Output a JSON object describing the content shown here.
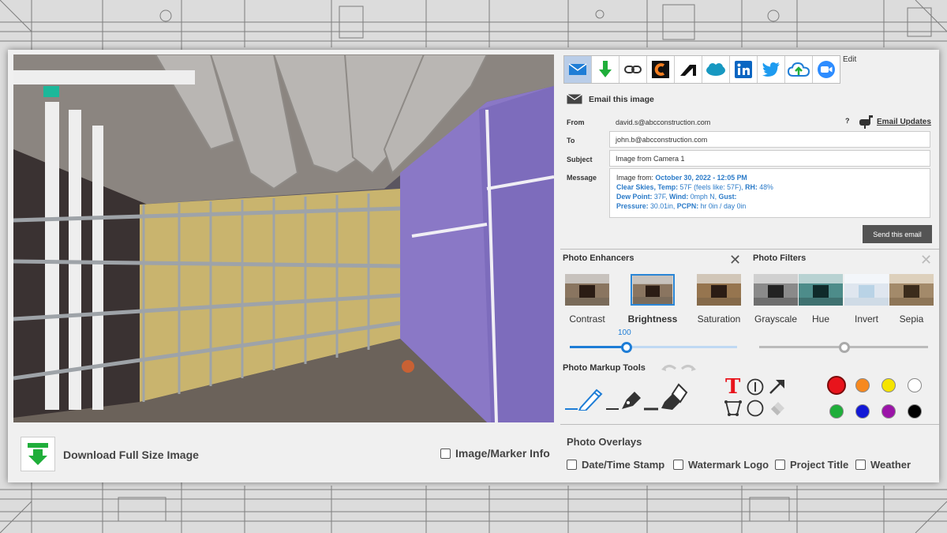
{
  "download": {
    "label": "Download Full Size Image"
  },
  "marker_info": {
    "label": "Image/Marker Info"
  },
  "share": {
    "icons": [
      "email-icon",
      "download-icon",
      "link-icon",
      "procore-icon",
      "autodesk-icon",
      "salesforce-icon",
      "linkedin-icon",
      "twitter-icon",
      "cloud-upload-icon",
      "zoom-icon"
    ],
    "edit_label": "Edit"
  },
  "email": {
    "title": "Email this image",
    "from_label": "From",
    "from_value": "david.s@abcconstruction.com",
    "help": "?",
    "updates_label": "Email Updates",
    "to_label": "To",
    "to_value": "john.b@abcconstruction.com",
    "subject_label": "Subject",
    "subject_value": "Image from Camera 1",
    "message_label": "Message",
    "message": {
      "l1a": "Image from: ",
      "l1b": "October 30, 2022 - 12:05 PM",
      "l2a": "Clear Skies, Temp: ",
      "l2b": "57F (feels like: 57F), ",
      "l2c": "RH: ",
      "l2d": "48%",
      "l3a": "Dew Point: ",
      "l3b": "37F, ",
      "l3c": "Wind: ",
      "l3d": "0mph N, ",
      "l3e": "Gust:",
      "l4a": "Pressure: ",
      "l4b": "30.01in, ",
      "l4c": "PCPN: ",
      "l4d": "hr 0in / day 0in"
    },
    "send_label": "Send this email"
  },
  "enhancers": {
    "title": "Photo Enhancers",
    "items": [
      "Contrast",
      "Brightness",
      "Saturation"
    ],
    "selected": "Brightness",
    "value": "100"
  },
  "filters": {
    "title": "Photo Filters",
    "items": [
      "Grayscale",
      "Hue",
      "Invert",
      "Sepia"
    ]
  },
  "markup": {
    "title": "Photo Markup Tools",
    "text_tool": "T",
    "colors": [
      "#e8141c",
      "#f7891f",
      "#f5e400",
      "#ffffff",
      "#1fae3a",
      "#1218d6",
      "#9b14a8",
      "#000000"
    ],
    "selected_color": "#e8141c"
  },
  "overlays": {
    "title": "Photo Overlays",
    "items": [
      "Date/Time Stamp",
      "Watermark Logo",
      "Project Title",
      "Weather"
    ]
  }
}
